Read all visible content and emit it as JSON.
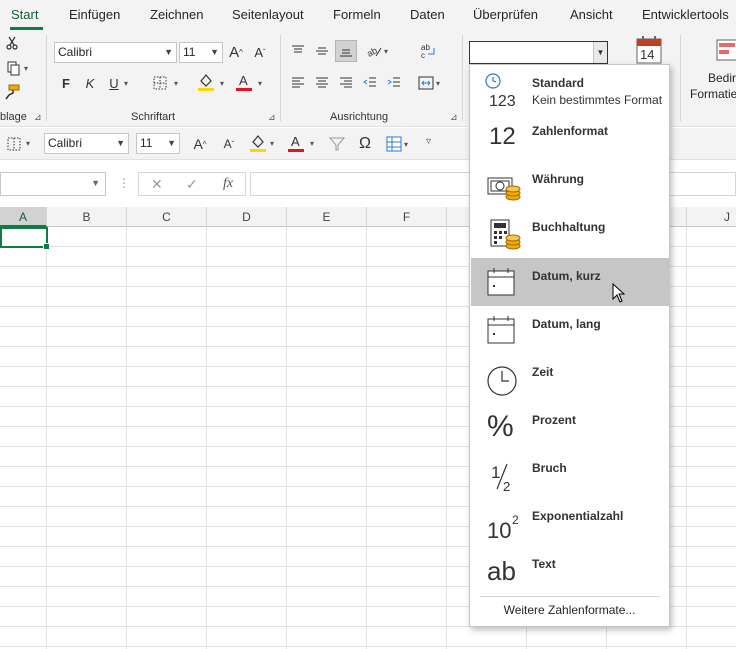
{
  "tabs": [
    "Start",
    "Einfügen",
    "Zeichnen",
    "Seitenlayout",
    "Formeln",
    "Daten",
    "Überprüfen",
    "Ansicht",
    "Entwicklertools"
  ],
  "ribbon": {
    "clipboard_label": "blage",
    "font_name": "Calibri",
    "font_size": "11",
    "font_group_label": "Schriftart",
    "align_group_label": "Ausrichtung",
    "bold": "F",
    "italic": "K",
    "underline": "U",
    "cond_format_partial_1": "Bedir",
    "cond_format_partial_2": "Formatie",
    "calendar_day": "14"
  },
  "qat": {
    "font_name": "Calibri",
    "font_size": "11"
  },
  "formula_bar": {
    "cancel": "✕",
    "enter": "✓",
    "fx": "fx"
  },
  "columns": [
    "A",
    "B",
    "C",
    "D",
    "E",
    "F",
    "J"
  ],
  "number_format": {
    "current_value": "",
    "items": [
      {
        "label": "Standard",
        "sub": "Kein bestimmtes Format",
        "icon": "clock-123-icon"
      },
      {
        "label": "Zahlenformat",
        "sub": "",
        "icon": "number-12-icon",
        "big": "12"
      },
      {
        "label": "Währung",
        "sub": "",
        "icon": "currency-icon"
      },
      {
        "label": "Buchhaltung",
        "sub": "",
        "icon": "accounting-icon"
      },
      {
        "label": "Datum, kurz",
        "sub": "",
        "icon": "calendar-short-icon"
      },
      {
        "label": "Datum, lang",
        "sub": "",
        "icon": "calendar-long-icon"
      },
      {
        "label": "Zeit",
        "sub": "",
        "icon": "clock-icon"
      },
      {
        "label": "Prozent",
        "sub": "",
        "icon": "percent-icon",
        "big": "%"
      },
      {
        "label": "Bruch",
        "sub": "",
        "icon": "fraction-icon"
      },
      {
        "label": "Exponentialzahl",
        "sub": "",
        "icon": "exponent-icon"
      },
      {
        "label": "Text",
        "sub": "",
        "icon": "text-ab-icon",
        "big": "ab"
      }
    ],
    "more": "Weitere Zahlenformate...",
    "highlighted_index": 4
  },
  "colors": {
    "accent": "#107c41",
    "highlight": "#c6c6c6",
    "font_color_bar": "#e81123",
    "fill_color_bar": "#ffd700"
  }
}
